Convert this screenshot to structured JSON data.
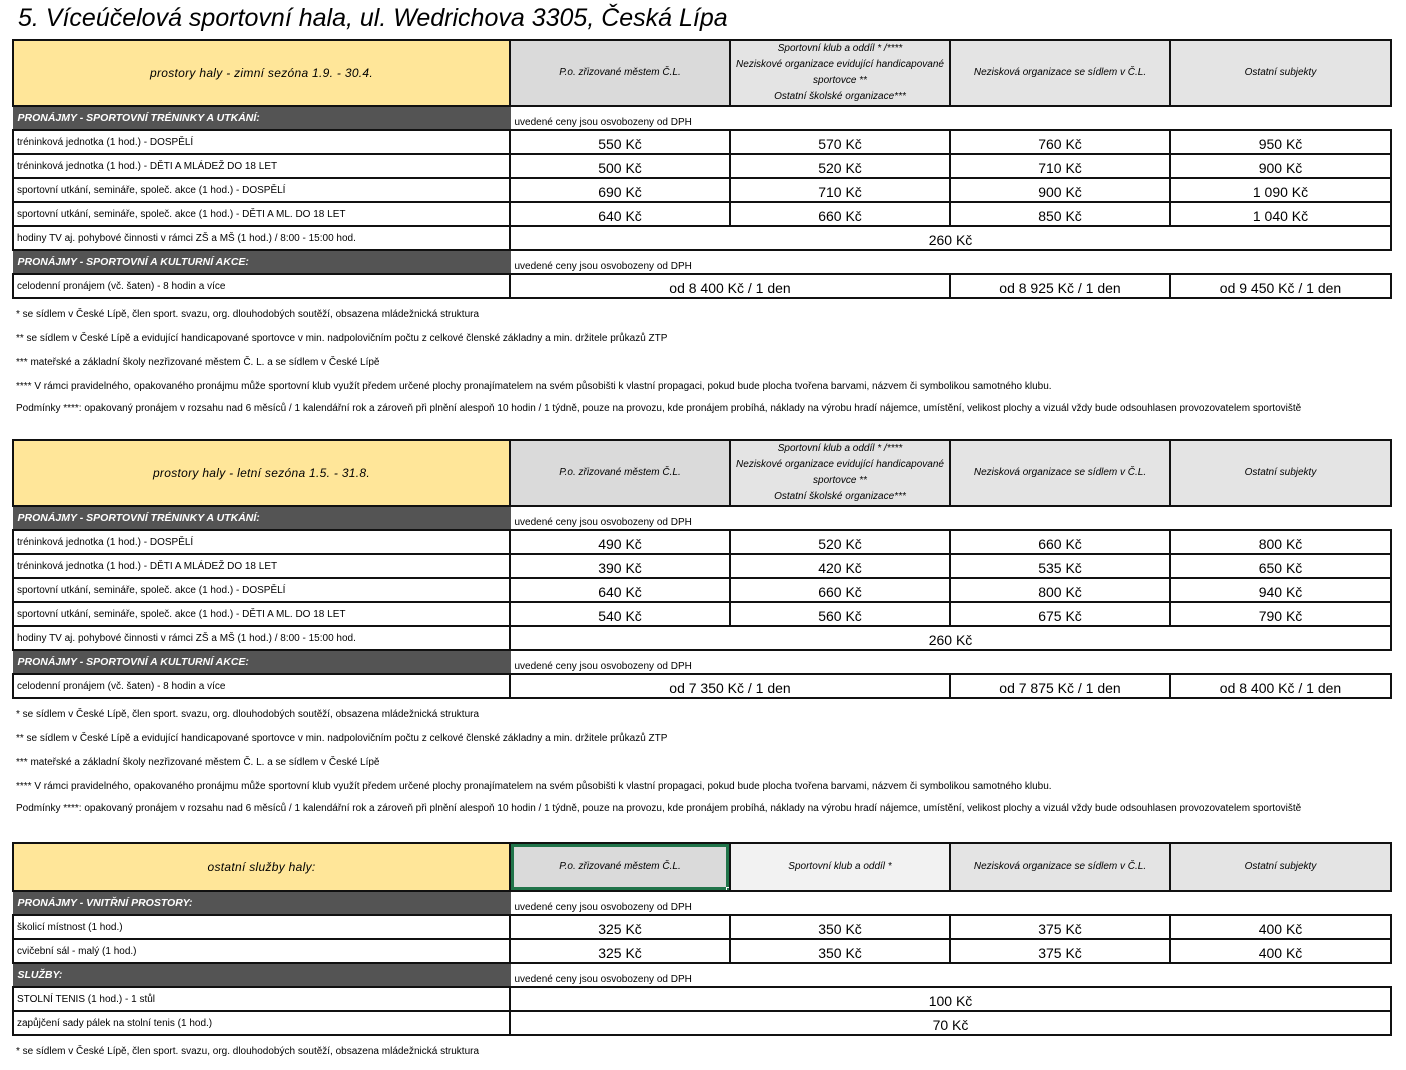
{
  "title": "5. Víceúčelová sportovní hala, ul. Wedrichova 3305, Česká Lípa",
  "columns_a": [
    "P.o. zřizované městem Č.L.",
    "Sportovní klub a oddíl * /****",
    "Neziskové organizace evidující handicapované sportovce **",
    "Ostatní školské organizace***",
    "Nezisková organizace se sídlem v Č.L.",
    "Ostatní subjekty"
  ],
  "winter": {
    "header_label": "prostory haly - zimní sezóna 1.9. - 30.4.",
    "section1_label": "PRONÁJMY - SPORTOVNÍ TRÉNINKY A UTKÁNÍ:",
    "section1_note": "uvedené ceny jsou osvobozeny od DPH",
    "rows": [
      {
        "label": "tréninková jednotka (1 hod.) - DOSPĚLÍ",
        "v": [
          "550 Kč",
          "570 Kč",
          "760 Kč",
          "950 Kč"
        ]
      },
      {
        "label": "tréninková jednotka (1 hod.) - DĚTI A MLÁDEŽ DO 18 LET",
        "v": [
          "500 Kč",
          "520 Kč",
          "710 Kč",
          "900 Kč"
        ]
      },
      {
        "label": "sportovní utkání, semináře, společ. akce (1 hod.) - DOSPĚLÍ",
        "v": [
          "690 Kč",
          "710 Kč",
          "900 Kč",
          "1 090 Kč"
        ]
      },
      {
        "label": "sportovní utkání, semináře, společ. akce (1 hod.) - DĚTI A ML. DO 18 LET",
        "v": [
          "640 Kč",
          "660 Kč",
          "850 Kč",
          "1 040 Kč"
        ]
      }
    ],
    "tv_label": "hodiny TV aj. pohybové činnosti v rámci ZŠ a MŠ (1 hod.) / 8:00 - 15:00 hod.",
    "tv_value": "260 Kč",
    "section2_label": "PRONÁJMY - SPORTOVNÍ A KULTURNÍ AKCE:",
    "section2_note": "uvedené ceny jsou osvobozeny od DPH",
    "day_label": "celodenní pronájem (vč. šaten) - 8 hodin a více",
    "day_values": [
      "od 8 400 Kč / 1 den",
      "od 8 925 Kč / 1 den",
      "od 9 450 Kč / 1 den"
    ],
    "notes": [
      "* se sídlem v České Lípě, člen sport. svazu, org. dlouhodobých soutěží, obsazena mládežnická struktura",
      "** se sídlem v České Lípě a evidující handicapované sportovce v min. nadpolovičním počtu z celkové členské základny a min. držitele průkazů ZTP",
      "*** mateřské a základní školy nezřizované městem Č. L. a se sídlem v České Lípě",
      "**** V rámci pravidelného, opakovaného pronájmu může sportovní klub využít předem určené plochy pronajímatelem na svém působišti k vlastní propagaci, pokud bude plocha tvořena barvami, názvem či symbolikou samotného klubu.",
      "Podmínky ****: opakovaný pronájem v rozsahu nad 6 měsíců / 1 kalendářní rok a zároveň při plnění alespoň 10 hodin / 1 týdně, pouze na provozu, kde pronájem probíhá, náklady na výrobu hradí nájemce, umístění, velikost plochy a vizuál vždy bude odsouhlasen provozovatelem sportoviště"
    ]
  },
  "summer": {
    "header_label": "prostory haly - letní sezóna 1.5. - 31.8.",
    "section1_label": "PRONÁJMY - SPORTOVNÍ TRÉNINKY A UTKÁNÍ:",
    "section1_note": "uvedené ceny jsou osvobozeny od DPH",
    "rows": [
      {
        "label": "tréninková jednotka (1 hod.) - DOSPĚLÍ",
        "v": [
          "490 Kč",
          "520 Kč",
          "660 Kč",
          "800 Kč"
        ]
      },
      {
        "label": "tréninková jednotka (1 hod.) - DĚTI A MLÁDEŽ DO 18 LET",
        "v": [
          "390 Kč",
          "420 Kč",
          "535 Kč",
          "650 Kč"
        ]
      },
      {
        "label": "sportovní utkání, semináře, společ. akce (1 hod.) - DOSPĚLÍ",
        "v": [
          "640 Kč",
          "660 Kč",
          "800 Kč",
          "940 Kč"
        ]
      },
      {
        "label": "sportovní utkání, semináře, společ. akce (1 hod.) - DĚTI A ML. DO 18 LET",
        "v": [
          "540 Kč",
          "560 Kč",
          "675 Kč",
          "790 Kč"
        ]
      }
    ],
    "tv_label": "hodiny TV aj. pohybové činnosti v rámci ZŠ a MŠ (1 hod.) / 8:00 - 15:00 hod.",
    "tv_value": "260 Kč",
    "section2_label": "PRONÁJMY - SPORTOVNÍ A KULTURNÍ AKCE:",
    "section2_note": "uvedené ceny jsou osvobozeny od DPH",
    "day_label": "celodenní pronájem (vč. šaten) - 8 hodin a více",
    "day_values": [
      "od 7 350 Kč / 1 den",
      "od 7 875 Kč / 1 den",
      "od 8 400 Kč / 1 den"
    ],
    "notes": [
      "* se sídlem v České Lípě, člen sport. svazu, org. dlouhodobých soutěží, obsazena mládežnická struktura",
      "** se sídlem v České Lípě a evidující handicapované sportovce v min. nadpolovičním počtu z celkové členské základny a min. držitele průkazů ZTP",
      "*** mateřské a základní školy nezřizované městem Č. L. a se sídlem v České Lípě",
      "**** V rámci pravidelného, opakovaného pronájmu může sportovní klub využít předem určené plochy pronajímatelem na svém působišti k vlastní propagaci, pokud bude plocha tvořena barvami, názvem či symbolikou samotného klubu.",
      "Podmínky ****: opakovaný pronájem v rozsahu nad 6 měsíců / 1 kalendářní rok a zároveň při plnění alespoň 10 hodin / 1 týdně, pouze na provozu, kde pronájem probíhá, náklady na výrobu hradí nájemce, umístění, velikost plochy a vizuál vždy bude odsouhlasen provozovatelem sportoviště"
    ]
  },
  "other": {
    "header_label": "ostatní služby haly:",
    "columns": [
      "P.o. zřizované městem Č.L.",
      "Sportovní klub a oddíl *",
      "Nezisková organizace se sídlem v Č.L.",
      "Ostatní subjekty"
    ],
    "section1_label": "PRONÁJMY - VNITŘNÍ PROSTORY:",
    "section1_note": "uvedené ceny jsou osvobozeny od DPH",
    "rows": [
      {
        "label": "školicí místnost (1 hod.)",
        "v": [
          "325 Kč",
          "350 Kč",
          "375 Kč",
          "400 Kč"
        ]
      },
      {
        "label": "cvičební sál - malý (1 hod.)",
        "v": [
          "325 Kč",
          "350 Kč",
          "375 Kč",
          "400 Kč"
        ]
      }
    ],
    "section2_label": "SLUŽBY:",
    "section2_note": "uvedené ceny jsou osvobozeny od DPH",
    "services": [
      {
        "label": "STOLNÍ TENIS (1 hod.) - 1 stůl",
        "value": "100 Kč"
      },
      {
        "label": "zapůjčení sady pálek na stolní tenis (1 hod.)",
        "value": "70 Kč"
      }
    ],
    "note": "* se sídlem v České Lípě, člen sport. svazu, org. dlouhodobých soutěží, obsazena mládežnická struktura"
  },
  "colors": {
    "header_yellow": "#ffe699",
    "header_grey": "#e4e4e4",
    "section_dark": "#545454",
    "selection_green": "#21744a"
  }
}
